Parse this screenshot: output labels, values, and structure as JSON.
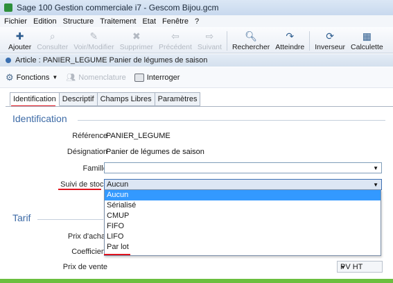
{
  "window": {
    "title": "Sage 100 Gestion commerciale i7 - Gescom Bijou.gcm"
  },
  "menu": [
    "Fichier",
    "Edition",
    "Structure",
    "Traitement",
    "Etat",
    "Fenêtre",
    "?"
  ],
  "toolbar": {
    "ajouter": "Ajouter",
    "consulter": "Consulter",
    "voir_modifier": "Voir/Modifier",
    "supprimer": "Supprimer",
    "precedent": "Précédent",
    "suivant": "Suivant",
    "rechercher": "Rechercher",
    "atteindre": "Atteindre",
    "inverseur": "Inverseur",
    "calculette": "Calculette"
  },
  "document": {
    "title": "Article : PANIER_LEGUME Panier de légumes de saison"
  },
  "subtoolbar": {
    "fonctions": "Fonctions",
    "nomenclature": "Nomenclature",
    "interroger": "Interroger"
  },
  "tabs": [
    "Identification",
    "Descriptif",
    "Champs Libres",
    "Paramètres"
  ],
  "identification": {
    "section_title": "Identification",
    "reference_label": "Référence",
    "reference_value": "PANIER_LEGUME",
    "designation_label": "Désignation",
    "designation_value": "Panier de légumes de saison",
    "famille_label": "Famille",
    "famille_value": "",
    "suivi_label": "Suivi de stock",
    "suivi_value": "Aucun"
  },
  "dropdown_options": [
    "Aucun",
    "Sérialisé",
    "CMUP",
    "FIFO",
    "LIFO",
    "Par lot"
  ],
  "tarif": {
    "section_title": "Tarif",
    "prix_achat_label": "Prix d'achat",
    "coefficient_label": "Coefficient",
    "prix_vente_label": "Prix de vente",
    "pv_type": "PV HT"
  },
  "colors": {
    "accent": "#3399ff",
    "annotation": "#e0141e",
    "section": "#3c6aa6",
    "footer_bar": "#6bbf3f"
  }
}
